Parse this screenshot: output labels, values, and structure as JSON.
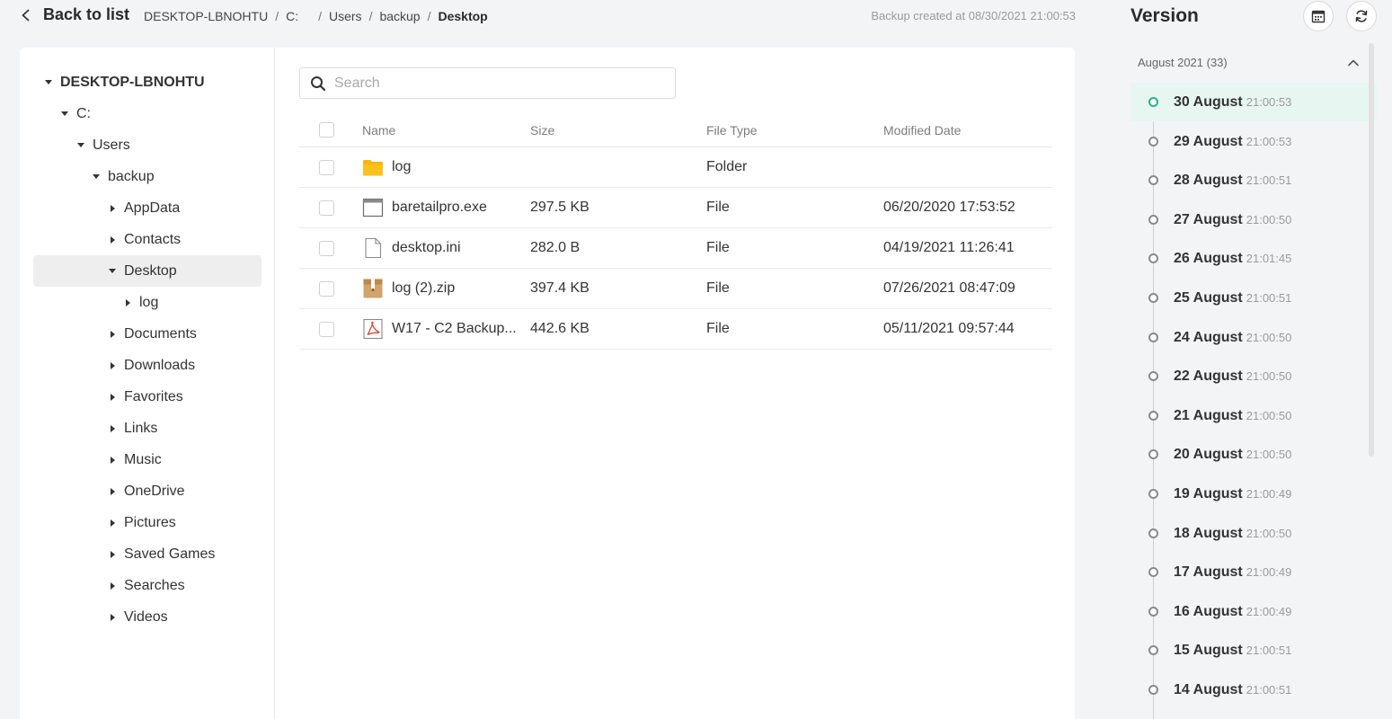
{
  "header": {
    "back_label": "Back to list",
    "breadcrumb": [
      "DESKTOP-LBNOHTU",
      "C:",
      "Users",
      "backup",
      "Desktop"
    ],
    "backup_info": "Backup created at 08/30/2021 21:00:53"
  },
  "tree": {
    "items": [
      {
        "label": "DESKTOP-LBNOHTU",
        "expanded": true
      },
      {
        "label": "C:",
        "expanded": true
      },
      {
        "label": "Users",
        "expanded": true
      },
      {
        "label": "backup",
        "expanded": true
      },
      {
        "label": "AppData",
        "expanded": false
      },
      {
        "label": "Contacts",
        "expanded": false
      },
      {
        "label": "Desktop",
        "expanded": true,
        "selected": true
      },
      {
        "label": "log",
        "expanded": false
      },
      {
        "label": "Documents",
        "expanded": false
      },
      {
        "label": "Downloads",
        "expanded": false
      },
      {
        "label": "Favorites",
        "expanded": false
      },
      {
        "label": "Links",
        "expanded": false
      },
      {
        "label": "Music",
        "expanded": false
      },
      {
        "label": "OneDrive",
        "expanded": false
      },
      {
        "label": "Pictures",
        "expanded": false
      },
      {
        "label": "Saved Games",
        "expanded": false
      },
      {
        "label": "Searches",
        "expanded": false
      },
      {
        "label": "Videos",
        "expanded": false
      }
    ]
  },
  "search": {
    "placeholder": "Search"
  },
  "table": {
    "columns": [
      "Name",
      "Size",
      "File Type",
      "Modified Date"
    ],
    "rows": [
      {
        "icon": "folder-icon",
        "name": "log",
        "size": "",
        "type": "Folder",
        "modified": ""
      },
      {
        "icon": "exe-file-icon",
        "name": "baretailpro.exe",
        "size": "297.5 KB",
        "type": "File",
        "modified": "06/20/2020 17:53:52"
      },
      {
        "icon": "document-file-icon",
        "name": "desktop.ini",
        "size": "282.0 B",
        "type": "File",
        "modified": "04/19/2021 11:26:41"
      },
      {
        "icon": "archive-file-icon",
        "name": "log (2).zip",
        "size": "397.4 KB",
        "type": "File",
        "modified": "07/26/2021 08:47:09"
      },
      {
        "icon": "pdf-file-icon",
        "name": "W17 - C2 Backup...",
        "size": "442.6 KB",
        "type": "File",
        "modified": "05/11/2021 09:57:44"
      }
    ]
  },
  "version": {
    "title": "Version",
    "group_label": "August 2021 (33)",
    "items": [
      {
        "date": "30 August",
        "time": "21:00:53",
        "selected": true
      },
      {
        "date": "29 August",
        "time": "21:00:53"
      },
      {
        "date": "28 August",
        "time": "21:00:51"
      },
      {
        "date": "27 August",
        "time": "21:00:50"
      },
      {
        "date": "26 August",
        "time": "21:01:45"
      },
      {
        "date": "25 August",
        "time": "21:00:51"
      },
      {
        "date": "24 August",
        "time": "21:00:50"
      },
      {
        "date": "22 August",
        "time": "21:00:50"
      },
      {
        "date": "21 August",
        "time": "21:00:50"
      },
      {
        "date": "20 August",
        "time": "21:00:50"
      },
      {
        "date": "19 August",
        "time": "21:00:49"
      },
      {
        "date": "18 August",
        "time": "21:00:50"
      },
      {
        "date": "17 August",
        "time": "21:00:49"
      },
      {
        "date": "16 August",
        "time": "21:00:49"
      },
      {
        "date": "15 August",
        "time": "21:00:51"
      },
      {
        "date": "14 August",
        "time": "21:00:51"
      }
    ]
  },
  "colors": {
    "accent": "#2bb08a",
    "folder": "#f5b50f",
    "pdf": "#d8432f"
  }
}
